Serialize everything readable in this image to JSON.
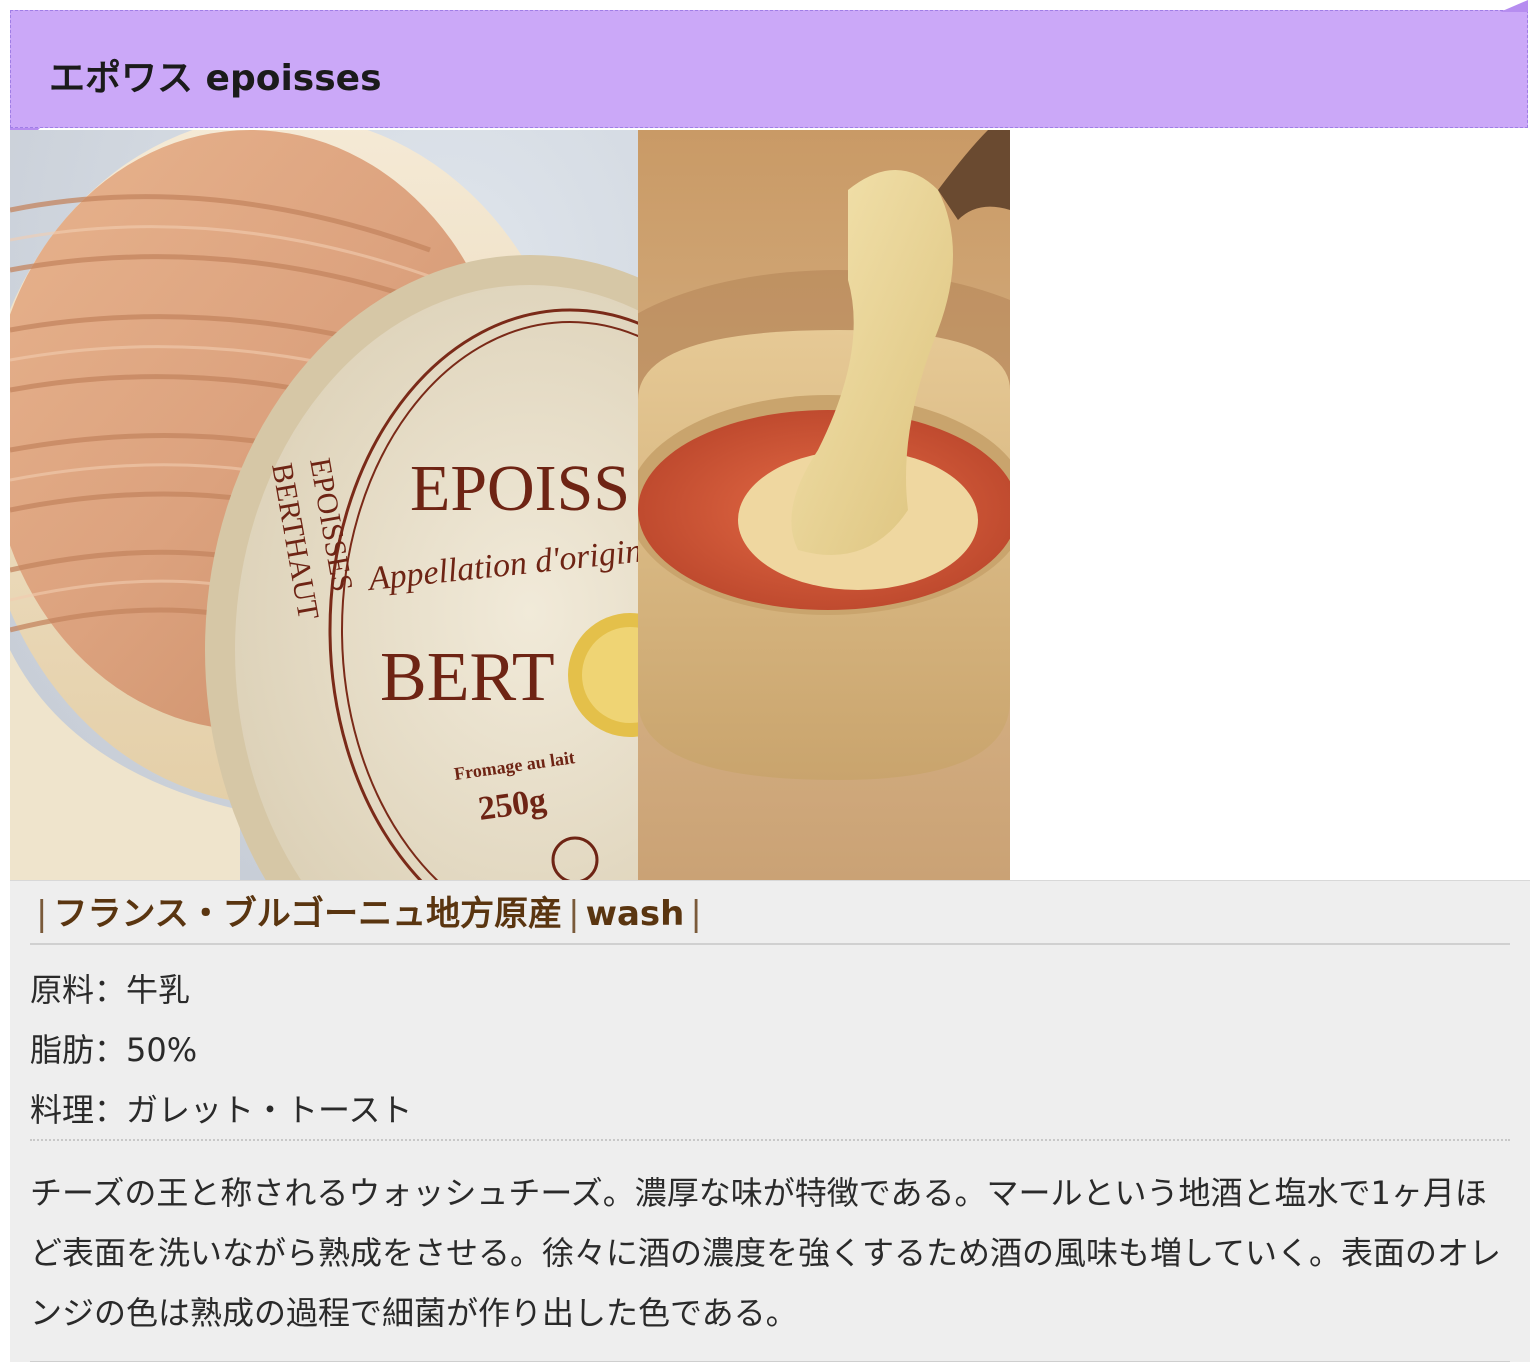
{
  "header": {
    "title": "エポワス epoisses"
  },
  "images": {
    "left": {
      "box_text_1": "EPOISS",
      "box_text_2": "Appellation d'origine",
      "box_text_3": "BERT",
      "side_text_1": "EPOISSES",
      "side_text_2": "BERTHAUT",
      "fromage": "Fromage au lait",
      "weight": "250g"
    }
  },
  "info": {
    "origin_region": "フランス・ブルゴーニュ地方原産",
    "origin_type": "wash",
    "sep": "|",
    "specs": [
      {
        "text": "原料：牛乳"
      },
      {
        "text": "脂肪：50%"
      },
      {
        "text": "料理：ガレット・トースト"
      }
    ],
    "description": "チーズの王と称されるウォッシュチーズ。濃厚な味が特徴である。マールという地酒と塩水で1ヶ月ほど表面を洗いながら熟成をさせる。徐々に酒の濃度を強くするため酒の風味も増していく。表面のオレンジの色は熟成の過程で細菌が作り出した色である。"
  },
  "colors": {
    "header_bg": "#cba8f8",
    "origin_text": "#5a3510",
    "info_bg": "#eeeeee"
  }
}
